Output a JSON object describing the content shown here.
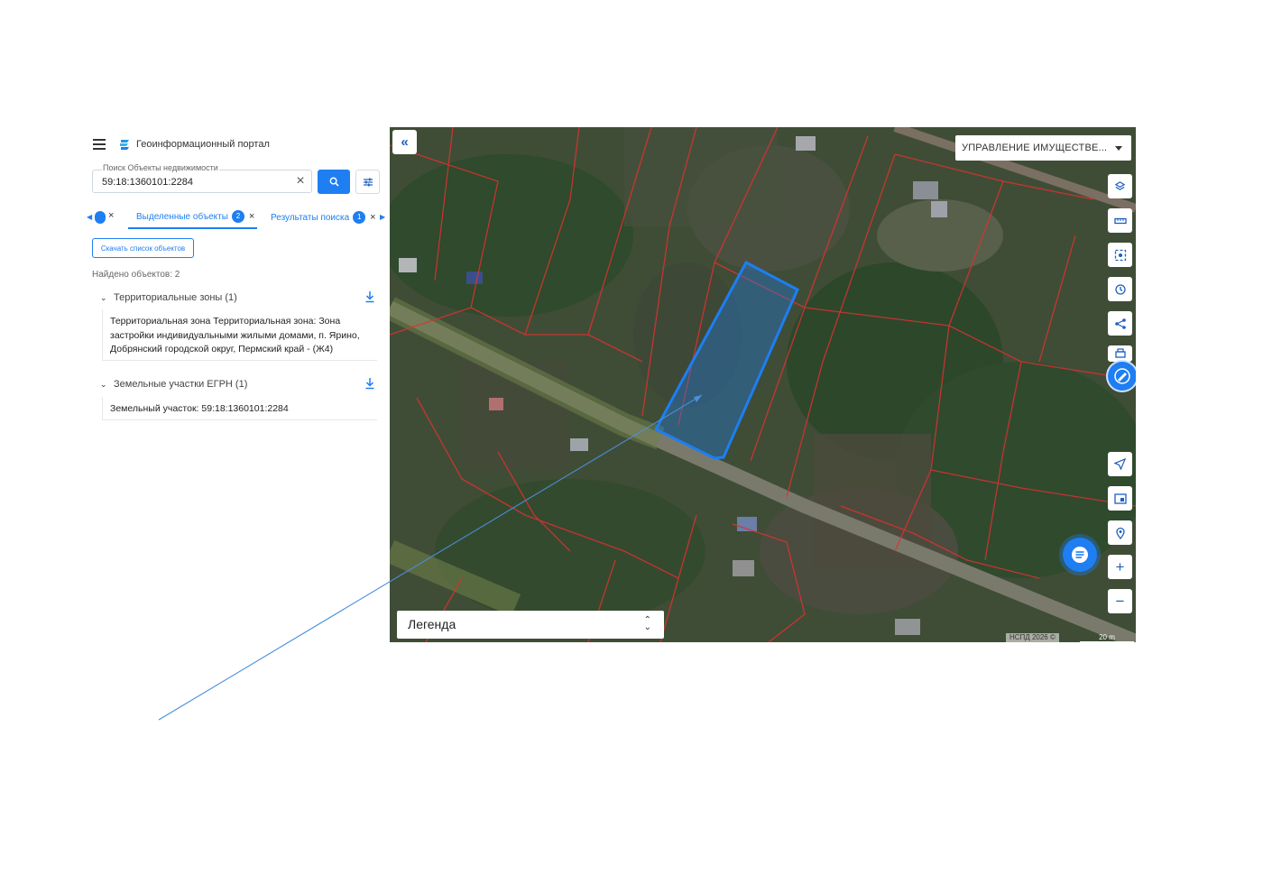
{
  "header": {
    "title": "Геоинформационный портал"
  },
  "search": {
    "label": "Поиск Объекты недвижимости",
    "value": "59:18:1360101:2284"
  },
  "tabs": [
    {
      "label": "Выделенные объекты",
      "count": "2",
      "active": true
    },
    {
      "label": "Результаты поиска",
      "count": "1",
      "active": false
    }
  ],
  "download_list_label": "Скачать список объектов",
  "found_text": "Найдено объектов: 2",
  "groups": [
    {
      "title": "Территориальные зоны (1)",
      "body": "Территориальная зона Территориальная зона: Зона застройки индивидуальными жилыми домами, п. Ярино, Добрянский городской округ, Пермский край - (Ж4)"
    },
    {
      "title": "Земельные участки ЕГРН (1)",
      "body": "Земельный участок: 59:18:1360101:2284"
    }
  ],
  "map": {
    "layer_select": "УПРАВЛЕНИЕ ИМУЩЕСТВЕ...",
    "legend_label": "Легенда",
    "attribution": "НСПД 2026 ©",
    "scale": "20 m",
    "tools": [
      "layers-icon",
      "ruler-icon",
      "area-select-icon",
      "history-icon",
      "share-icon",
      "print-icon",
      "locate-icon",
      "minimap-icon",
      "geo-search-icon",
      "zoom-in-icon",
      "zoom-out-icon"
    ]
  },
  "colors": {
    "accent": "#1e7ef2",
    "parcel_border": "#e03030",
    "selected_parcel": "#1e7ef2"
  }
}
